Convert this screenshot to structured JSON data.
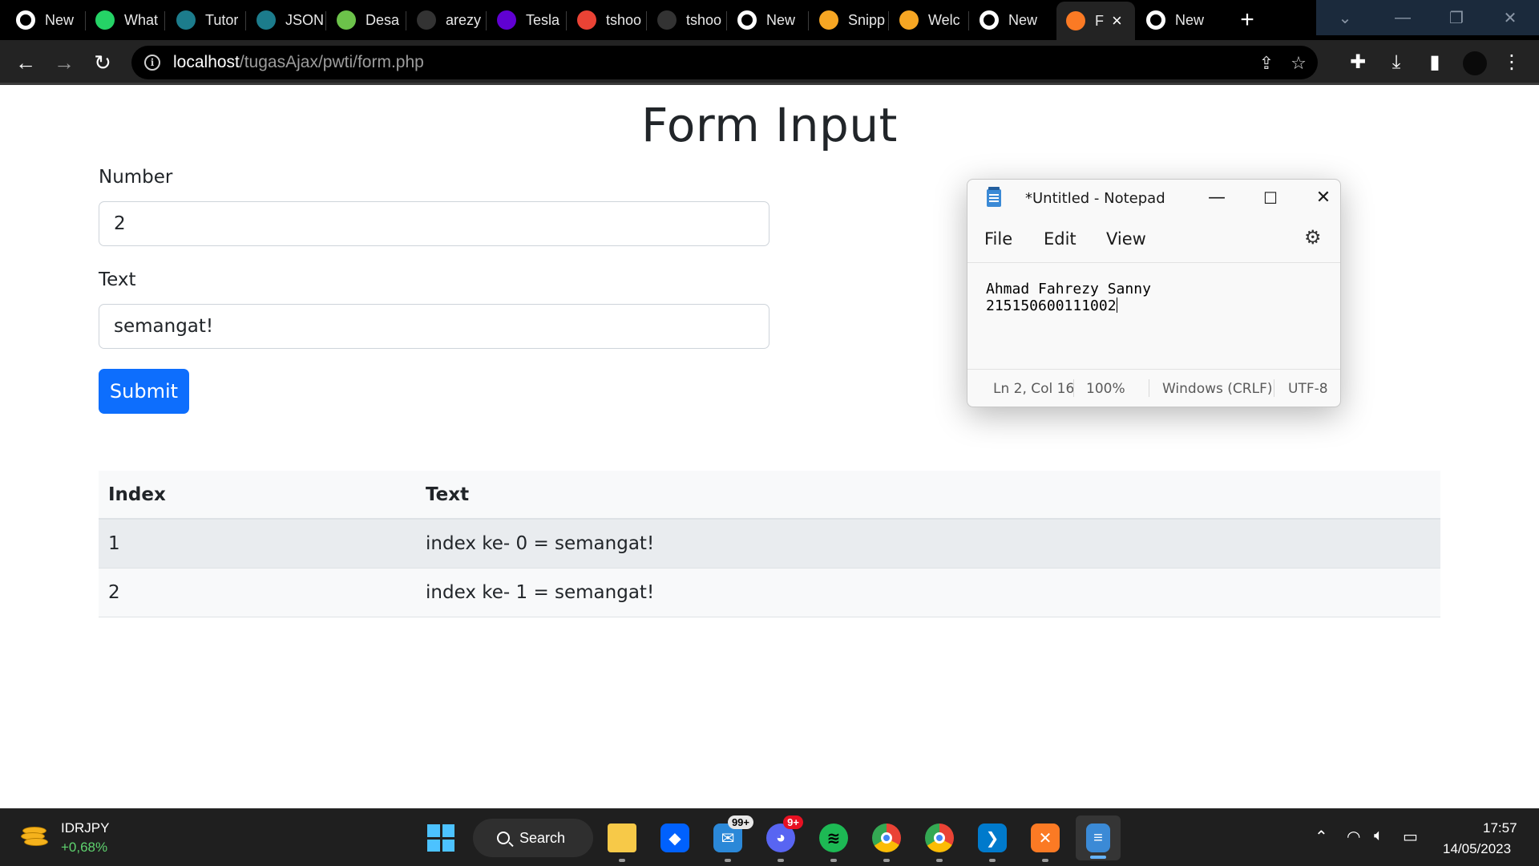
{
  "browser": {
    "tabs": [
      {
        "label": "New",
        "icon": "chrome-icon",
        "color": "#ffffff"
      },
      {
        "label": "What",
        "icon": "whatsapp-icon",
        "color": "#25d366"
      },
      {
        "label": "Tutor",
        "icon": "tutorial-icon",
        "color": "#1c7c8c"
      },
      {
        "label": "JSON",
        "icon": "tutorial-icon",
        "color": "#1c7c8c"
      },
      {
        "label": "Desa",
        "icon": "leaf-icon",
        "color": "#6cc24a"
      },
      {
        "label": "arezy",
        "icon": "github-icon",
        "color": "#333333"
      },
      {
        "label": "Tesla",
        "icon": "yahoo-icon",
        "color": "#6001d2"
      },
      {
        "label": "tshoo",
        "icon": "gmail-icon",
        "color": "#ea4335"
      },
      {
        "label": "tshoo",
        "icon": "github-icon",
        "color": "#333333"
      },
      {
        "label": "New",
        "icon": "chrome-icon",
        "color": "#ffffff"
      },
      {
        "label": "Snipp",
        "icon": "codepen-icon",
        "color": "#f6a623"
      },
      {
        "label": "Welc",
        "icon": "codepen-icon",
        "color": "#f6a623"
      },
      {
        "label": "New",
        "icon": "chrome-icon",
        "color": "#ffffff"
      },
      {
        "label": "F",
        "icon": "xampp-icon",
        "color": "#fb7a24"
      },
      {
        "label": "New",
        "icon": "chrome-icon",
        "color": "#ffffff"
      }
    ],
    "new_tab": "+",
    "url_host": "localhost",
    "url_path": "/tugasAjax/pwti/form.php"
  },
  "page": {
    "title": "Form Input",
    "number_label": "Number",
    "number_value": "2",
    "text_label": "Text",
    "text_value": "semangat!",
    "submit_label": "Submit",
    "table": {
      "headers": [
        "Index",
        "Text"
      ],
      "rows": [
        [
          "1",
          "index ke- 0 = semangat!"
        ],
        [
          "2",
          "index ke- 1 = semangat!"
        ]
      ]
    },
    "accent": "#0d6efd"
  },
  "notepad": {
    "title": "*Untitled - Notepad",
    "menu": [
      "File",
      "Edit",
      "View"
    ],
    "lines": [
      "Ahmad Fahrezy Sanny",
      "215150600111002"
    ],
    "status": {
      "position": "Ln 2, Col 16",
      "zoom": "100%",
      "line_ending": "Windows (CRLF)",
      "encoding": "UTF-8"
    }
  },
  "taskbar": {
    "ticker_name": "IDRJPY",
    "ticker_change": "+0,68%",
    "search_label": "Search",
    "mail_badge": "99+",
    "discord_badge": "9+",
    "time": "17:57",
    "date": "14/05/2023"
  }
}
